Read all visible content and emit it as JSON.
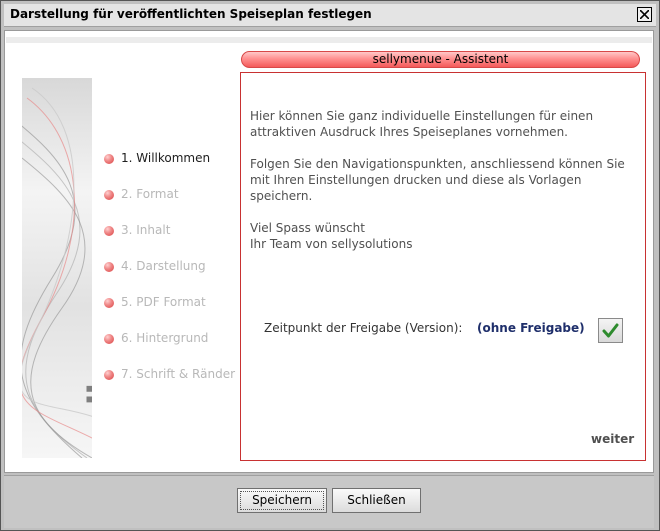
{
  "window": {
    "title": "Darstellung für veröffentlichten Speiseplan festlegen"
  },
  "branding": {
    "part1": "selly",
    "part2": "menue"
  },
  "wizard": {
    "header": "sellymenue - Assistent",
    "steps": [
      {
        "label": "1. Willkommen",
        "active": true
      },
      {
        "label": "2. Format",
        "active": false
      },
      {
        "label": "3. Inhalt",
        "active": false
      },
      {
        "label": "4. Darstellung",
        "active": false
      },
      {
        "label": "5. PDF Format",
        "active": false
      },
      {
        "label": "6. Hintergrund",
        "active": false
      },
      {
        "label": "7. Schrift & Ränder",
        "active": false
      }
    ],
    "intro_lines": [
      "Hier können Sie ganz individuelle Einstellungen für einen",
      "attraktiven Ausdruck Ihres Speiseplanes vornehmen."
    ],
    "nav_lines": [
      "Folgen Sie den Navigationspunkten, anschliessend können Sie",
      "mit Ihren Einstellungen drucken und diese als Vorlagen",
      "speichern."
    ],
    "greeting_lines": [
      "Viel Spass wünscht",
      "Ihr Team von sellysolutions"
    ],
    "release_label": "Zeitpunkt der Freigabe (Version):",
    "release_value": "(ohne Freigabe)",
    "next": "weiter"
  },
  "footer": {
    "save": "Speichern",
    "close": "Schließen"
  },
  "colors": {
    "accent": "#e53b3b",
    "value_blue": "#1f2f6b",
    "check_green": "#2e8b2e"
  },
  "icons": {
    "close": "close-icon",
    "confirm": "checkmark-icon"
  }
}
